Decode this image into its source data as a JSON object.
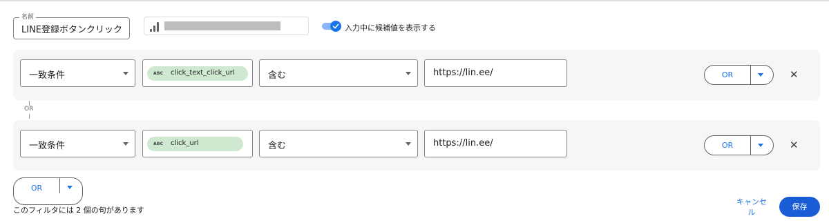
{
  "name_field": {
    "legend": "名前",
    "value": "LINE登録ボタンクリック"
  },
  "data_source": {
    "icon": "signal-bars-icon"
  },
  "suggestions_toggle": {
    "label": "入力中に候補値を表示する",
    "checked": true
  },
  "conditions": [
    {
      "match_type": "一致条件",
      "variable": {
        "type_badge": "ABC",
        "name": "click_text_click_url"
      },
      "operator": "含む",
      "value": "https://lin.ee/",
      "or_button": "OR"
    },
    {
      "match_type": "一致条件",
      "variable": {
        "type_badge": "ABC",
        "name": "click_url"
      },
      "operator": "含む",
      "value": "https://lin.ee/",
      "or_button": "OR"
    }
  ],
  "connector_label": "OR",
  "bottom_or_button": "OR",
  "footer": {
    "summary": "このフィルタには 2 個の句があります",
    "cancel_line1": "キャンセ",
    "cancel_line2": "ル",
    "save_label": "保存"
  },
  "colors": {
    "accent": "#1a73e8",
    "chip": "#cfe8d0",
    "save": "#1a5cd6"
  }
}
